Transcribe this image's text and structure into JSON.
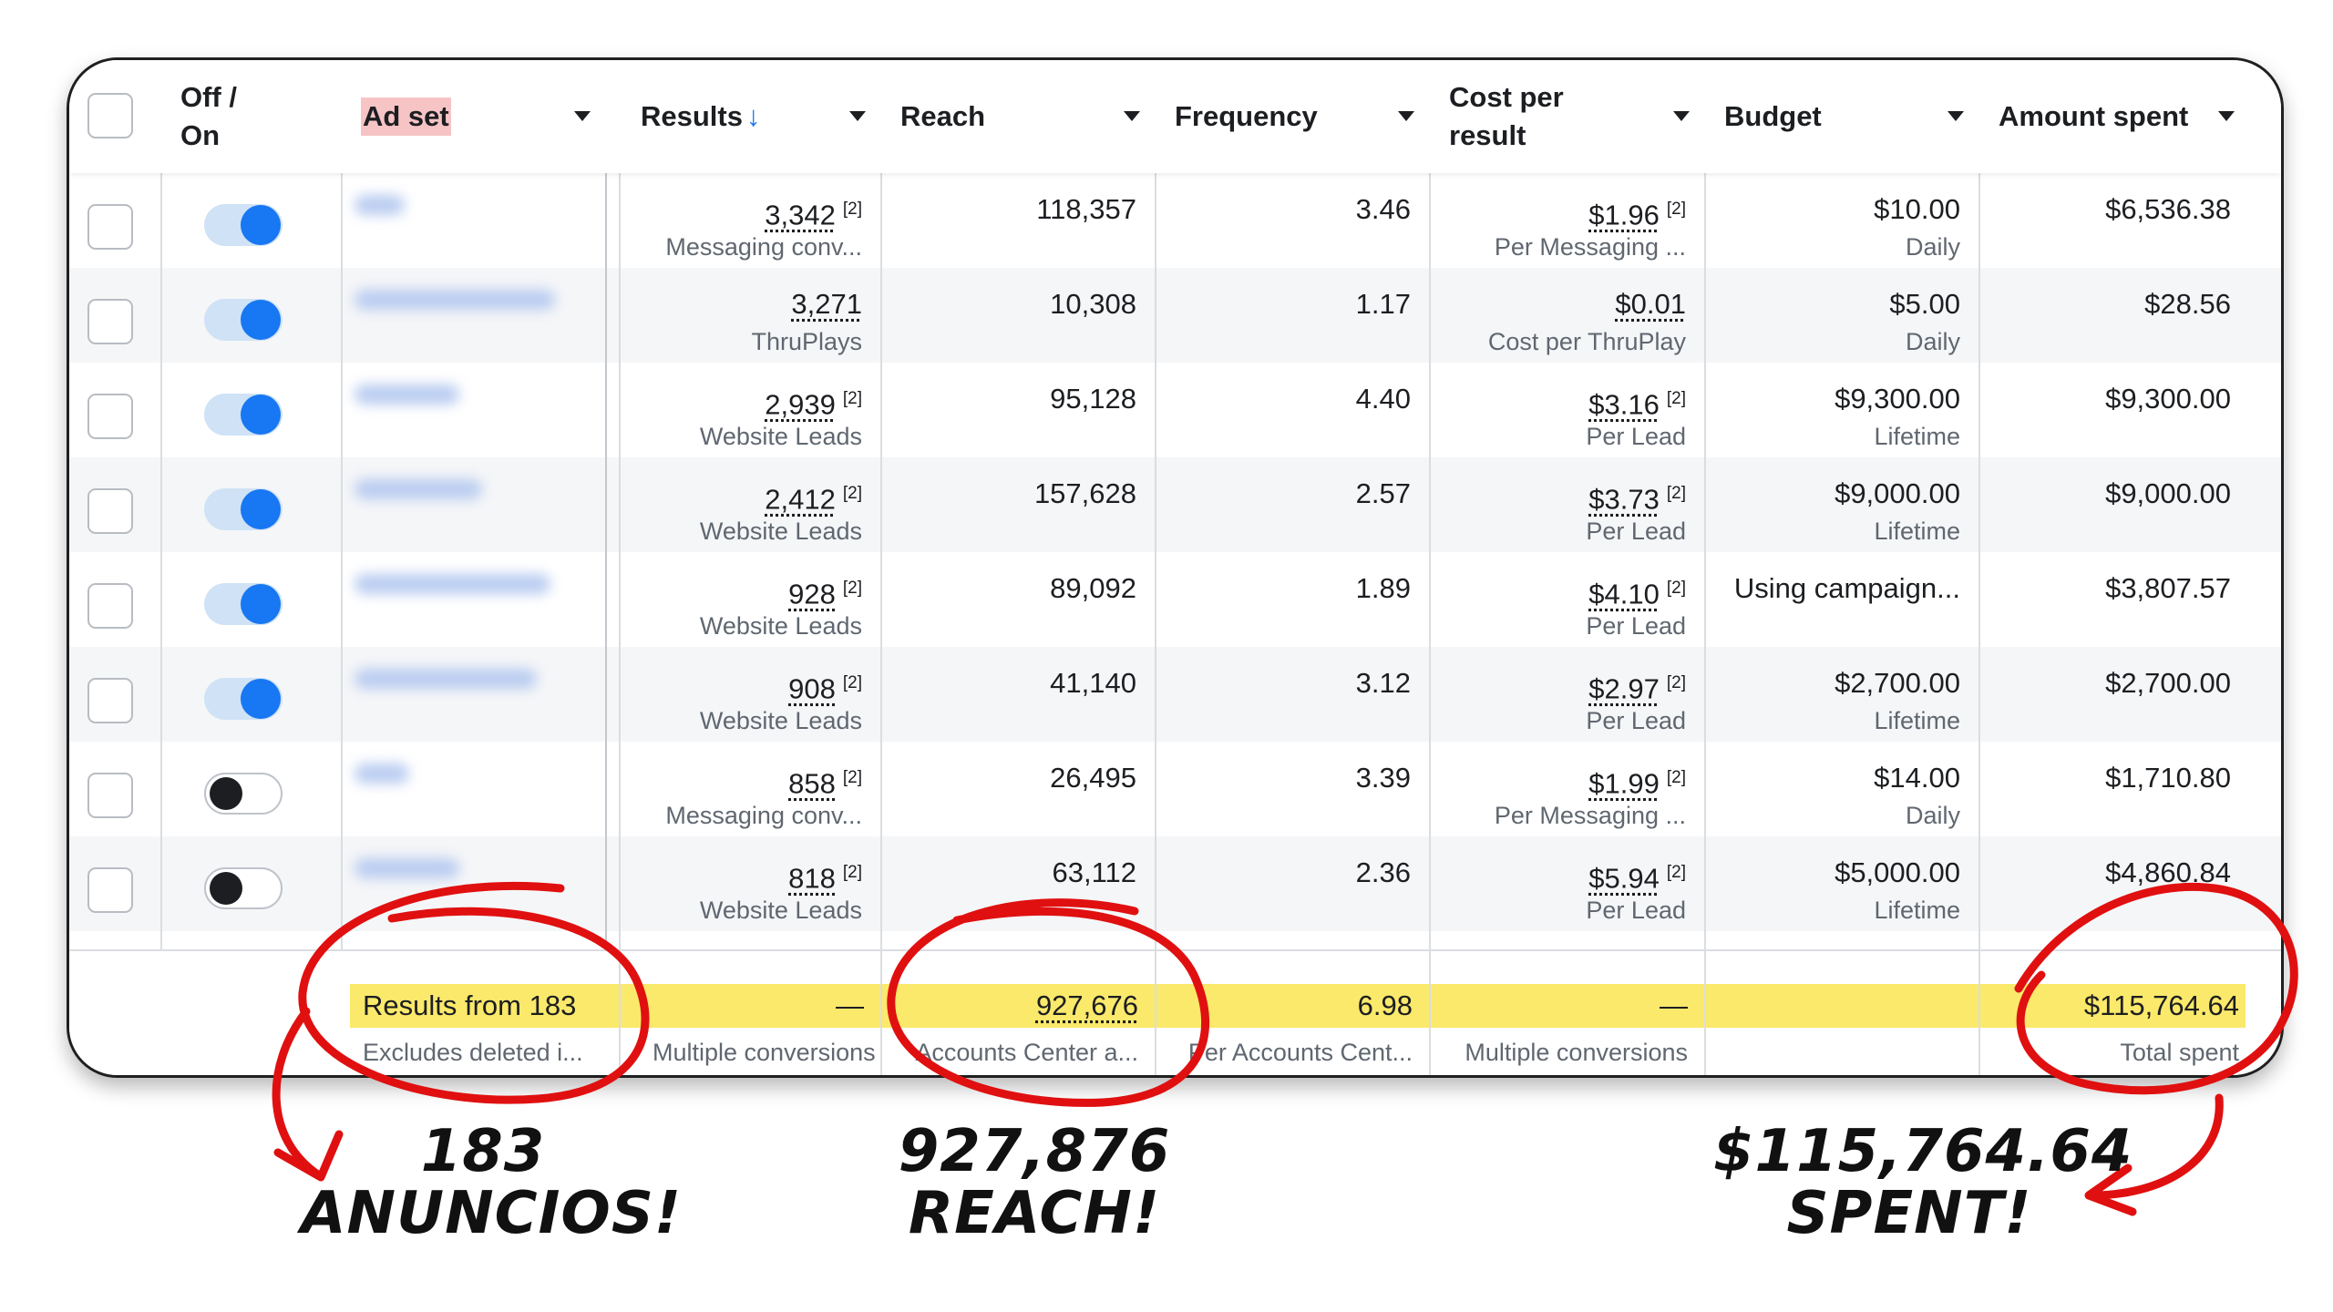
{
  "header": {
    "off_on_label": "Off / On",
    "ad_set_label": "Ad set",
    "results_label": "Results",
    "sort_arrow": "↓",
    "reach_label": "Reach",
    "frequency_label": "Frequency",
    "cost_per_result_label": "Cost per result",
    "budget_label": "Budget",
    "amount_spent_label": "Amount spent"
  },
  "rows": [
    {
      "toggle": "on",
      "results": "3,342",
      "results_sup": "[2]",
      "results_type": "Messaging conv...",
      "reach": "118,357",
      "frequency": "3.46",
      "cost": "$1.96",
      "cost_sup": "[2]",
      "cost_type": "Per Messaging ...",
      "budget": "$10.00",
      "budget_type": "Daily",
      "spent": "$6,536.38"
    },
    {
      "toggle": "on",
      "results": "3,271",
      "results_sup": "",
      "results_type": "ThruPlays",
      "reach": "10,308",
      "frequency": "1.17",
      "cost": "$0.01",
      "cost_sup": "",
      "cost_type": "Cost per ThruPlay",
      "budget": "$5.00",
      "budget_type": "Daily",
      "spent": "$28.56"
    },
    {
      "toggle": "on",
      "results": "2,939",
      "results_sup": "[2]",
      "results_type": "Website Leads",
      "reach": "95,128",
      "frequency": "4.40",
      "cost": "$3.16",
      "cost_sup": "[2]",
      "cost_type": "Per Lead",
      "budget": "$9,300.00",
      "budget_type": "Lifetime",
      "spent": "$9,300.00"
    },
    {
      "toggle": "on",
      "results": "2,412",
      "results_sup": "[2]",
      "results_type": "Website Leads",
      "reach": "157,628",
      "frequency": "2.57",
      "cost": "$3.73",
      "cost_sup": "[2]",
      "cost_type": "Per Lead",
      "budget": "$9,000.00",
      "budget_type": "Lifetime",
      "spent": "$9,000.00"
    },
    {
      "toggle": "on",
      "results": "928",
      "results_sup": "[2]",
      "results_type": "Website Leads",
      "reach": "89,092",
      "frequency": "1.89",
      "cost": "$4.10",
      "cost_sup": "[2]",
      "cost_type": "Per Lead",
      "budget": "Using campaign...",
      "budget_type": "",
      "spent": "$3,807.57"
    },
    {
      "toggle": "on",
      "results": "908",
      "results_sup": "[2]",
      "results_type": "Website Leads",
      "reach": "41,140",
      "frequency": "3.12",
      "cost": "$2.97",
      "cost_sup": "[2]",
      "cost_type": "Per Lead",
      "budget": "$2,700.00",
      "budget_type": "Lifetime",
      "spent": "$2,700.00"
    },
    {
      "toggle": "off",
      "results": "858",
      "results_sup": "[2]",
      "results_type": "Messaging conv...",
      "reach": "26,495",
      "frequency": "3.39",
      "cost": "$1.99",
      "cost_sup": "[2]",
      "cost_type": "Per Messaging ...",
      "budget": "$14.00",
      "budget_type": "Daily",
      "spent": "$1,710.80"
    },
    {
      "toggle": "off",
      "results": "818",
      "results_sup": "[2]",
      "results_type": "Website Leads",
      "reach": "63,112",
      "frequency": "2.36",
      "cost": "$5.94",
      "cost_sup": "[2]",
      "cost_type": "Per Lead",
      "budget": "$5,000.00",
      "budget_type": "Lifetime",
      "spent": "$4,860.84"
    }
  ],
  "summary": {
    "adset": "Results from 183",
    "adset_sub": "Excludes deleted i...",
    "results": "—",
    "results_sub": "Multiple conversions",
    "reach": "927,676",
    "reach_sub": "Accounts Center a...",
    "frequency": "6.98",
    "frequency_sub": "Per Accounts Cent...",
    "cost": "—",
    "cost_sub": "Multiple conversions",
    "spent": "$115,764.64",
    "spent_sub": "Total spent"
  },
  "annotations": {
    "note_1_line1": "183",
    "note_1_line2": "ANUNCIOS!",
    "note_2_line1": "927,876",
    "note_2_line2": "REACH!",
    "note_3_line1": "$115,764.64",
    "note_3_line2": "SPENT!",
    "ink_color": "#e01010"
  }
}
